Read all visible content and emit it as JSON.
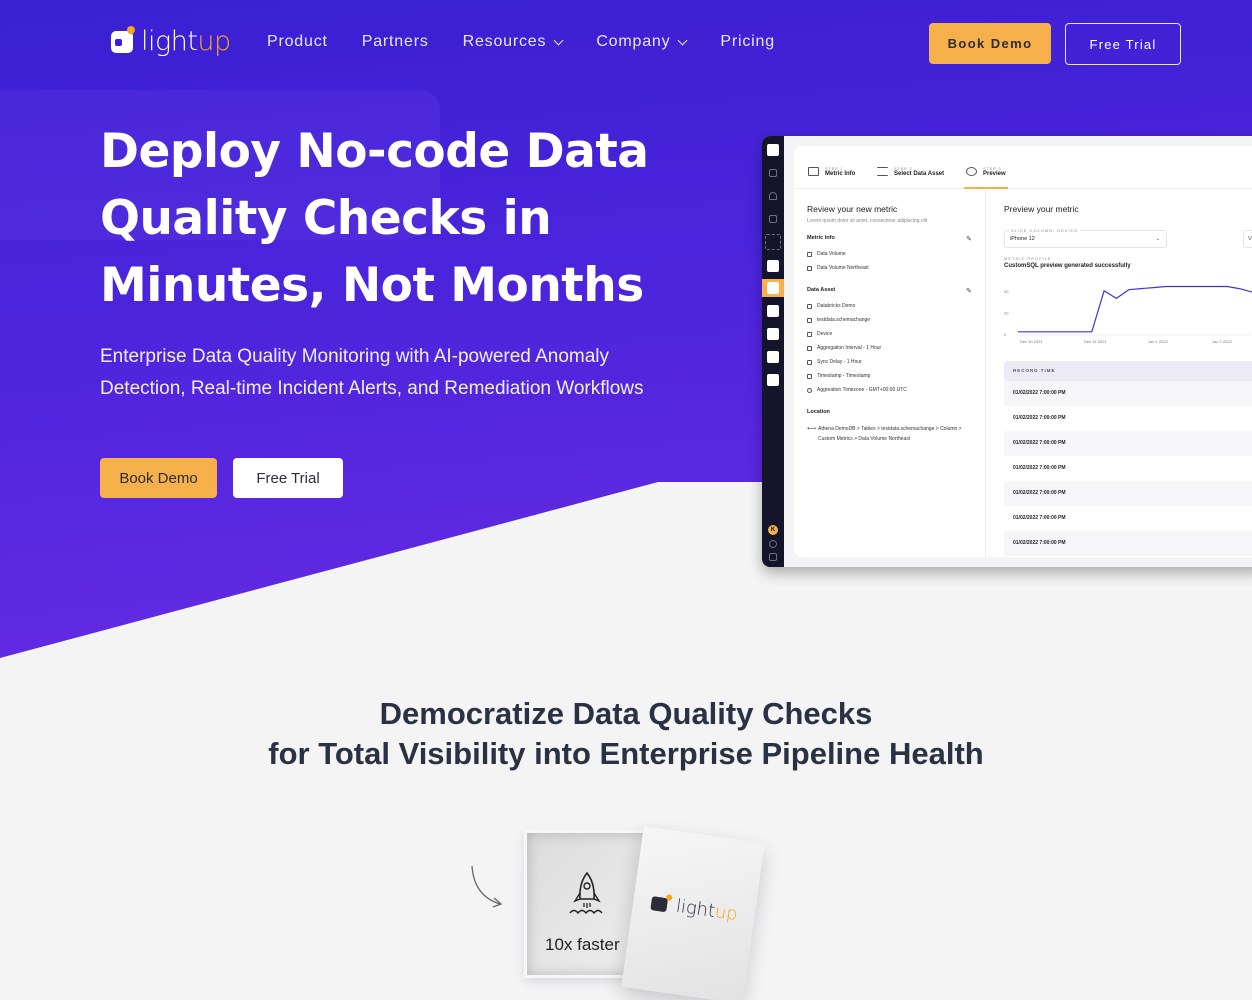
{
  "brand": {
    "name_prefix": "light",
    "name_suffix": "up",
    "accent": "#f5a623",
    "hero_color": "#3a1fd2"
  },
  "nav": {
    "links": [
      {
        "label": "Product",
        "has_dropdown": false
      },
      {
        "label": "Partners",
        "has_dropdown": false
      },
      {
        "label": "Resources",
        "has_dropdown": true
      },
      {
        "label": "Company",
        "has_dropdown": true
      },
      {
        "label": "Pricing",
        "has_dropdown": false
      }
    ],
    "book_demo": "Book Demo",
    "free_trial": "Free Trial"
  },
  "hero": {
    "title": "Deploy No-code Data Quality Checks in Minutes, Not Months",
    "subtitle": "Enterprise Data Quality Monitoring with AI-powered Anomaly Detection, Real-time Incident Alerts, and Remediation Workflows",
    "book_demo": "Book Demo",
    "free_trial": "Free Trial"
  },
  "app": {
    "avatar_initial": "K",
    "steps": [
      {
        "small": "STEP 1",
        "label": "Metric Info"
      },
      {
        "small": "STEP 2",
        "label": "Select Data Asset"
      },
      {
        "small": "STEP 3",
        "label": "Preview"
      }
    ],
    "left": {
      "title": "Review your new metric",
      "subtitle": "Lorem ipsum dolor sit amet, consectetur adipiscing elit",
      "metric_info_label": "Metric Info",
      "metric_info_items": [
        "Data Volume",
        "Data Volume Northeast"
      ],
      "data_asset_label": "Data Asset",
      "data_asset_items": [
        "Databricks Demo",
        "testdata.schemachange",
        "Device",
        "Aggregation Interval - 1 Hour",
        "Sync Delay - 1 Hour",
        "Timestamp - Timestamp",
        "Aggreation Timezone - GMT+00:00 UTC"
      ],
      "location_label": "Location",
      "location_value": "Athena DemoDB > Tables > testdata.schemachange > Column > Custom Metrics > Data Volume Northeast"
    },
    "right": {
      "title": "Preview your metric",
      "slice_label": "SLICE COLUMN: DEVICE",
      "slice_value": "iPhone 12",
      "second_select_value": "V",
      "profile_label": "METRIC PROFILE",
      "profile_message": "CustomSQL preview generated successfully",
      "chart": {
        "y_ticks": [
          "0",
          "20",
          "40"
        ],
        "x_ticks": [
          "Dec 30 2021",
          "Dec 31 2021",
          "Jan 1 2022",
          "Jan 2 2022"
        ],
        "series": [
          2,
          2,
          2,
          2,
          2,
          2,
          2,
          40,
          33,
          41,
          42,
          43,
          44,
          44,
          44,
          44,
          44,
          44,
          42,
          39,
          39
        ],
        "ymax": 50
      },
      "table_header": "RECORD TIME",
      "rows": [
        "01/02/2022 7:00:00 PM",
        "01/02/2022 7:00:00 PM",
        "01/02/2022 7:00:00 PM",
        "01/02/2022 7:00:00 PM",
        "01/02/2022 7:00:00 PM",
        "01/02/2022 7:00:00 PM",
        "01/02/2022 7:00:00 PM"
      ]
    }
  },
  "section2": {
    "title_line1": "Democratize Data Quality Checks",
    "title_line2": "for Total Visibility into Enterprise Pipeline Health",
    "box_text": "10x faster"
  }
}
